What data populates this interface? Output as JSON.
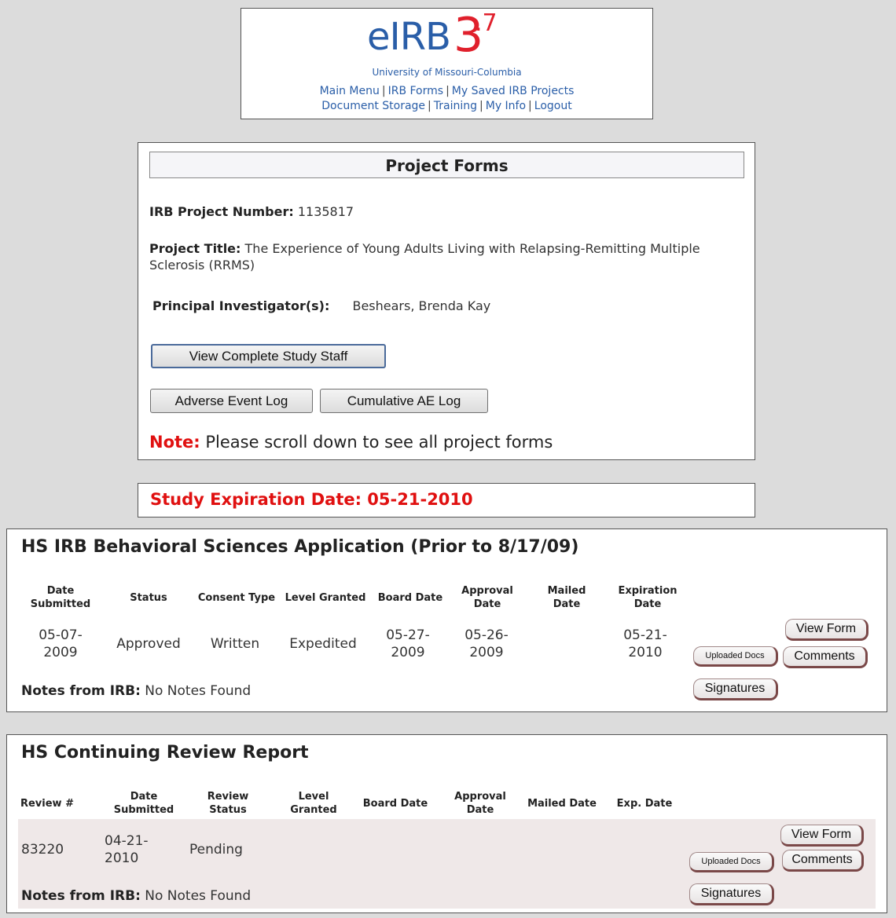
{
  "header": {
    "logo_main": "eIRB",
    "logo_version_major": "3",
    "logo_version_minor": ".7",
    "logo_sub": "University of Missouri-Columbia",
    "nav_row1": [
      "Main Menu",
      "IRB Forms",
      "My Saved IRB Projects"
    ],
    "nav_row2": [
      "Document Storage",
      "Training",
      "My Info",
      "Logout"
    ],
    "separator": "|"
  },
  "project": {
    "heading": "Project Forms",
    "number_label": "IRB Project Number:",
    "number_value": "1135817",
    "title_label": "Project Title:",
    "title_value_line1": "The Experience of Young Adults Living with Relapsing-Remitting Multiple",
    "title_value_line2": "Sclerosis (RRMS)",
    "pi_label": "Principal Investigator(s):",
    "pi_value": "Beshears, Brenda Kay",
    "btn_staff": "View Complete Study Staff",
    "btn_ae_log": "Adverse Event Log",
    "btn_cum_ae": "Cumulative AE Log",
    "note_label": "Note:",
    "note_text": "Please scroll down to see all project forms"
  },
  "expiration": {
    "text": "Study Expiration Date: 05-21-2010"
  },
  "app_section": {
    "title": "HS IRB Behavioral Sciences Application (Prior to 8/17/09)",
    "headers": {
      "date_submitted_1": "Date",
      "date_submitted_2": "Submitted",
      "status": "Status",
      "consent": "Consent Type",
      "level": "Level Granted",
      "board": "Board Date",
      "approval_1": "Approval",
      "approval_2": "Date",
      "mailed_1": "Mailed",
      "mailed_2": "Date",
      "expiration_1": "Expiration",
      "expiration_2": "Date"
    },
    "row": {
      "date_submitted_1": "05-07-",
      "date_submitted_2": "2009",
      "status": "Approved",
      "consent": "Written",
      "level": "Expedited",
      "board_1": "05-27-",
      "board_2": "2009",
      "approval_1": "05-26-",
      "approval_2": "2009",
      "mailed": "",
      "expiration_1": "05-21-",
      "expiration_2": "2010"
    },
    "buttons": {
      "view_form": "View Form",
      "comments": "Comments",
      "uploaded": "Uploaded Docs",
      "signatures": "Signatures"
    },
    "notes_label": "Notes from IRB:",
    "notes_value": "No Notes Found"
  },
  "cr_section": {
    "title": "HS Continuing Review Report",
    "headers": {
      "review_num": "Review #",
      "date_submitted_1": "Date",
      "date_submitted_2": "Submitted",
      "review_status_1": "Review",
      "review_status_2": "Status",
      "level_1": "Level",
      "level_2": "Granted",
      "board": "Board Date",
      "approval_1": "Approval",
      "approval_2": "Date",
      "mailed": "Mailed Date",
      "exp": "Exp. Date"
    },
    "row": {
      "review_num": "83220",
      "date_submitted_1": "04-21-",
      "date_submitted_2": "2010",
      "review_status": "Pending"
    },
    "buttons": {
      "view_form": "View Form",
      "comments": "Comments",
      "uploaded": "Uploaded Docs",
      "signatures": "Signatures"
    },
    "notes_label": "Notes from IRB:",
    "notes_value": "No Notes Found"
  }
}
